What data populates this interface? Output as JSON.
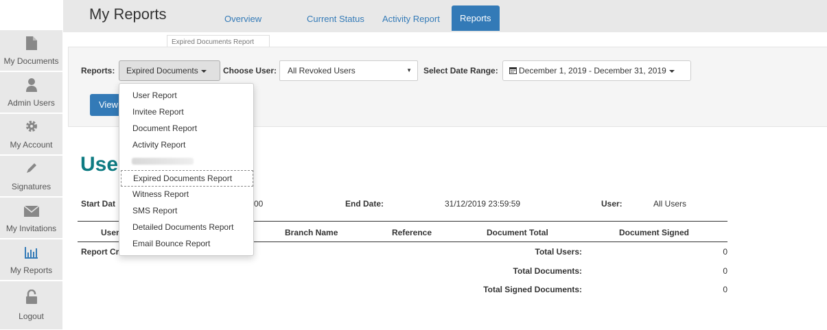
{
  "sidebar": {
    "items": [
      {
        "label": "My Documents",
        "icon": "document-icon"
      },
      {
        "label": "Admin Users",
        "icon": "user-icon"
      },
      {
        "label": "My Account",
        "icon": "gear-icon"
      },
      {
        "label": "Signatures",
        "icon": "pencil-icon"
      },
      {
        "label": "My Invitations",
        "icon": "envelope-icon"
      },
      {
        "label": "My Reports",
        "icon": "bar-chart-icon"
      },
      {
        "label": "Logout",
        "icon": "unlock-icon"
      }
    ],
    "accent": "#337ab7"
  },
  "header": {
    "title": "My Reports",
    "tabs": [
      {
        "label": "Overview"
      },
      {
        "label": "Current Status"
      },
      {
        "label": "Activity Report"
      },
      {
        "label": "Reports",
        "active": true
      }
    ]
  },
  "tooltip": "Expired Documents Report",
  "filters": {
    "reports_label": "Reports:",
    "reports_value": "Expired Documents",
    "user_label": "Choose User:",
    "user_value": "All Revoked Users",
    "date_label": "Select Date Range:",
    "date_value": "December 1, 2019 - December 31, 2019",
    "view_label": "View"
  },
  "dropdown": {
    "items": [
      "User Report",
      "Invitee Report",
      "Document Report",
      "Activity Report",
      "",
      "Expired Documents Report",
      "Witness Report",
      "SMS Report",
      "Detailed Documents Report",
      "Email Bounce Report"
    ],
    "selected": "Expired Documents Report"
  },
  "report": {
    "heading": "Use",
    "start_label": "Start Dat",
    "start_value_tail": "00",
    "end_label": "End Date:",
    "end_value": "31/12/2019 23:59:59",
    "user_label": "User:",
    "user_value": "All Users",
    "columns": [
      "User",
      "Branch Name",
      "Reference",
      "Document Total",
      "Document Signed"
    ],
    "report_row_label": "Report Cr",
    "summary": [
      {
        "label": "Total Users:",
        "value": "0"
      },
      {
        "label": "Total Documents:",
        "value": "0"
      },
      {
        "label": "Total Signed Documents:",
        "value": "0"
      }
    ]
  },
  "colors": {
    "heading": "#0e7b82",
    "primary": "#337ab7",
    "sidebar_bg": "#e8e8e8"
  }
}
